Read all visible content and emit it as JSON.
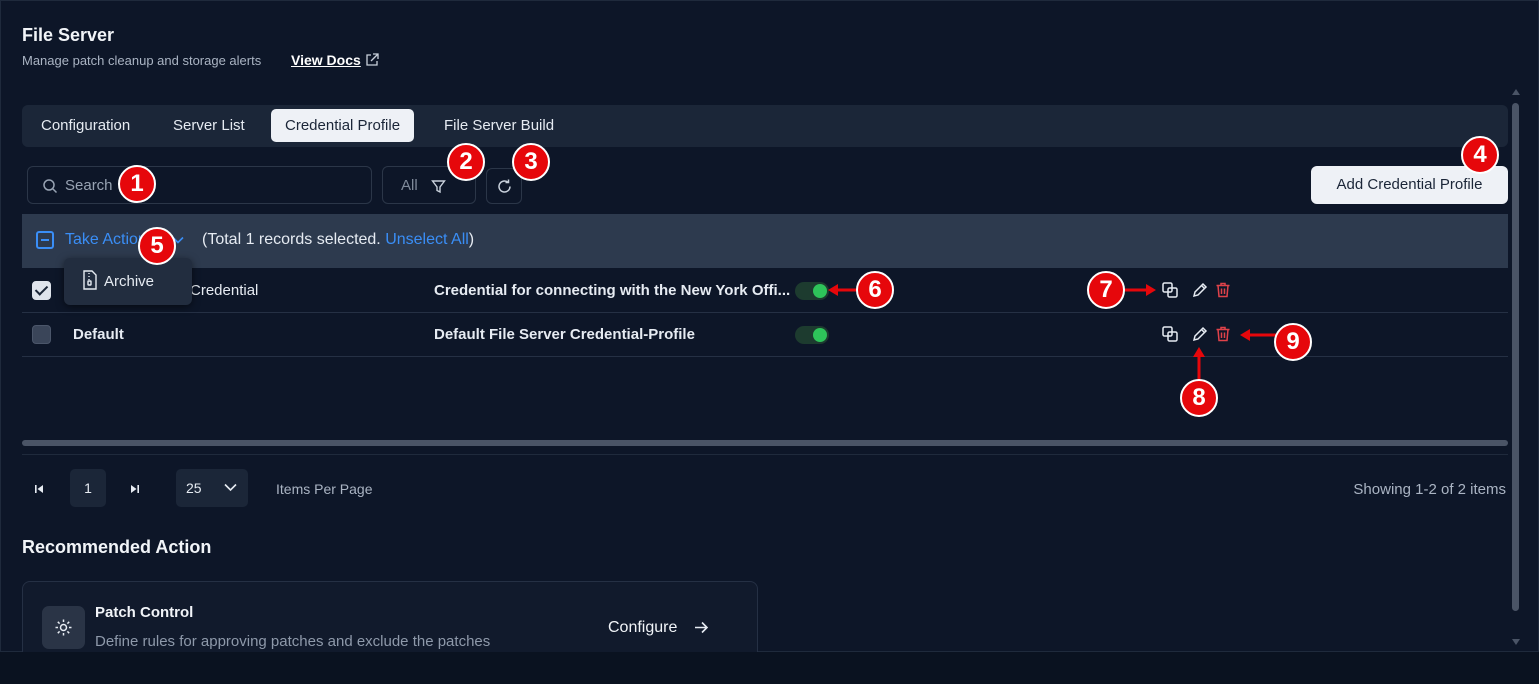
{
  "header": {
    "title": "File Server",
    "subtitle": "Manage patch cleanup and storage alerts",
    "docs_link": "View Docs"
  },
  "tabs": [
    {
      "label": "Configuration",
      "active": false
    },
    {
      "label": "Server List",
      "active": false
    },
    {
      "label": "Credential Profile",
      "active": true
    },
    {
      "label": "File Server Build",
      "active": false
    }
  ],
  "toolbar": {
    "search_placeholder": "Search",
    "filter_label": "All",
    "add_button": "Add Credential Profile"
  },
  "action_bar": {
    "take_action": "Take Action",
    "selection_text": "(Total 1 records selected. ",
    "unselect_all": "Unselect All",
    "selection_close": ")"
  },
  "dropdown": {
    "items": [
      {
        "label": "Archive",
        "icon": "archive-file-icon"
      }
    ]
  },
  "table": {
    "rows": [
      {
        "name": "Credential",
        "description": "Credential for connecting with the New York Offi...",
        "enabled": true,
        "checked": true
      },
      {
        "name": "Default",
        "description": "Default File Server Credential-Profile",
        "enabled": true,
        "checked": false
      }
    ]
  },
  "pagination": {
    "current_page": "1",
    "page_size": "25",
    "items_per_page_label": "Items Per Page",
    "showing": "Showing 1-2 of 2 items"
  },
  "recommended": {
    "title": "Recommended Action",
    "card": {
      "name": "Patch Control",
      "description": "Define rules for approving patches and exclude the patches",
      "action": "Configure"
    }
  },
  "markers": [
    "1",
    "2",
    "3",
    "4",
    "5",
    "6",
    "7",
    "8",
    "9"
  ],
  "colors": {
    "background": "#0d1628",
    "accent": "#3a8ef6",
    "toggle_on": "#2ec45a",
    "delete": "#e0424a",
    "marker": "#e6070b"
  }
}
